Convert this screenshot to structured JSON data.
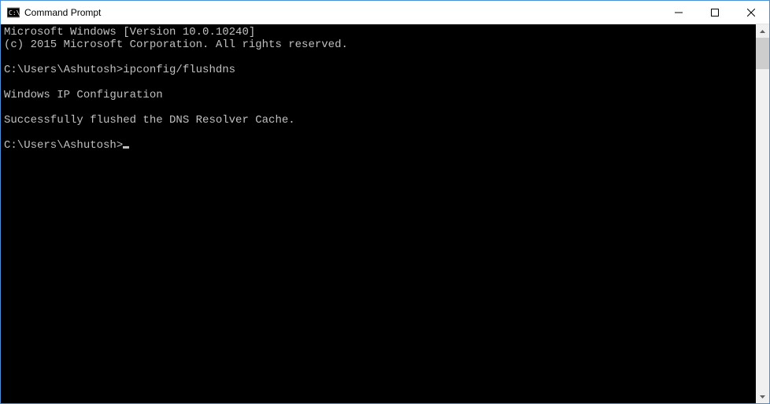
{
  "window": {
    "title": "Command Prompt"
  },
  "terminal": {
    "lines": [
      "Microsoft Windows [Version 10.0.10240]",
      "(c) 2015 Microsoft Corporation. All rights reserved.",
      "",
      "C:\\Users\\Ashutosh>ipconfig/flushdns",
      "",
      "Windows IP Configuration",
      "",
      "Successfully flushed the DNS Resolver Cache.",
      ""
    ],
    "prompt": "C:\\Users\\Ashutosh>"
  }
}
